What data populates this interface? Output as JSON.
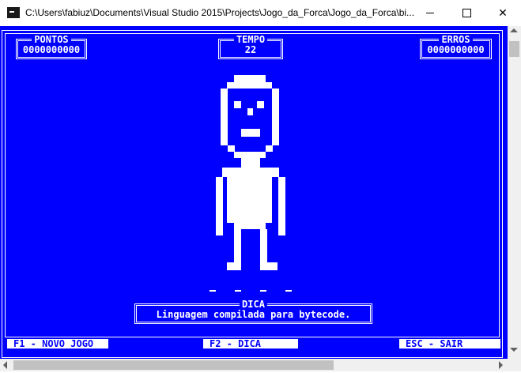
{
  "window": {
    "title": "C:\\Users\\fabiuz\\Documents\\Visual Studio 2015\\Projects\\Jogo_da_Forca\\Jogo_da_Forca\\bi..."
  },
  "colors": {
    "console_background": "#0000ff",
    "console_foreground": "#ffffff"
  },
  "hud": {
    "pontos": {
      "label": "PONTOS",
      "value": "0000000000"
    },
    "tempo": {
      "label": "TEMPO",
      "value": "22"
    },
    "erros": {
      "label": "ERROS",
      "value": "0000000000"
    }
  },
  "word": {
    "blanks": [
      "_",
      "_",
      "_",
      "_"
    ]
  },
  "dica": {
    "label": "DICA",
    "text": "Linguagem compilada para bytecode."
  },
  "footer": {
    "novo_jogo": "F1 - NOVO JOGO",
    "dica": "F2 - DICA",
    "sair": "ESC - SAIR"
  }
}
